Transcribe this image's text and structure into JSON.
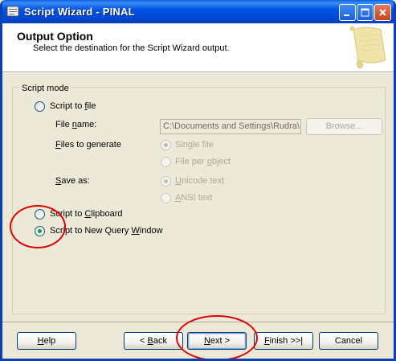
{
  "window": {
    "title": "Script Wizard - PINAL"
  },
  "header": {
    "title": "Output Option",
    "subtitle": "Select the destination for the Script Wizard output."
  },
  "group": {
    "label": "Script mode"
  },
  "script_to_file": {
    "label_pre": "Script to ",
    "label_key": "f",
    "label_post": "ile",
    "selected": false
  },
  "file_name": {
    "label_pre": "File ",
    "label_key": "n",
    "label_post": "ame:",
    "value": "C:\\Documents and Settings\\Rudra\\",
    "browse_label": "Browse..."
  },
  "files_to_generate": {
    "label_pre": "",
    "label_key": "F",
    "label_post": "iles to generate",
    "options": [
      "Single file",
      "File per object"
    ],
    "option2_pre": "File per ",
    "option2_key": "o",
    "option2_post": "bject",
    "selected": "Single file"
  },
  "save_as": {
    "label_pre": "",
    "label_key": "S",
    "label_post": "ave as:",
    "opt1_pre": "",
    "opt1_key": "U",
    "opt1_post": "nicode text",
    "opt2_pre": "",
    "opt2_key": "A",
    "opt2_post": "NSI text",
    "selected": "Unicode text"
  },
  "script_to_clipboard": {
    "label_pre": "Script to ",
    "label_key": "C",
    "label_post": "lipboard",
    "selected": false
  },
  "script_to_query_window": {
    "label_pre": "Script to New Query ",
    "label_key": "W",
    "label_post": "indow",
    "selected": true
  },
  "buttons": {
    "help_key": "H",
    "help_post": "elp",
    "back_pre": "< ",
    "back_key": "B",
    "back_post": "ack",
    "next_key": "N",
    "next_post": "ext >",
    "finish_key": "F",
    "finish_post": "inish >>|",
    "cancel": "Cancel"
  },
  "colors": {
    "titlebar": "#0054e3",
    "dialog_bg": "#ece9d8",
    "highlight_circle": "#e00000",
    "radio_dot": "#21a121"
  }
}
